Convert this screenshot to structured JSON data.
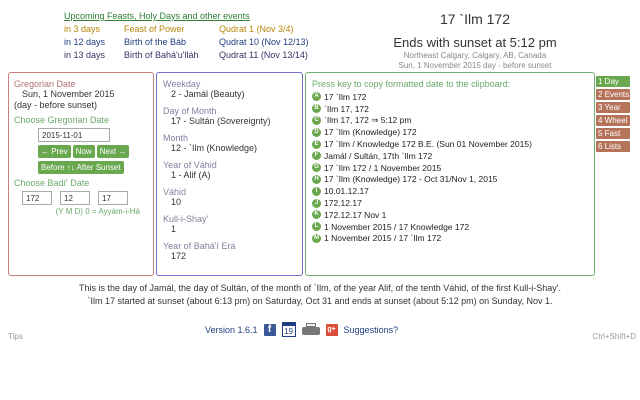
{
  "upcoming": {
    "header": "Upcoming Feasts, Holy Days and other events",
    "rows": [
      {
        "when": "in 3 days",
        "what": "Feast of Power",
        "date": "Qudrat 1 (Nov 3/4)"
      },
      {
        "when": "in 12 days",
        "what": "Birth of the Báb",
        "date": "Qudrat 10 (Nov 12/13)"
      },
      {
        "when": "in 13 days",
        "what": "Birth of Bahá'u'lláh",
        "date": "Qudrat 11 (Nov 13/14)"
      }
    ]
  },
  "today": {
    "badi_date": "17 `Ilm 172",
    "sunset": "Ends with sunset at 5:12 pm",
    "location": "Northeast Calgary, Calgary, AB, Canada",
    "greg_note": "Sun, 1 November 2015 day - before sunset"
  },
  "gregorian": {
    "title": "Gregorian Date",
    "value": "Sun, 1 November 2015",
    "note": "(day - before sunset)",
    "choose_label": "Choose Gregorian Date",
    "input_value": "2015-11-01",
    "prev": "← Prev",
    "now": "Now",
    "next": "Next →",
    "before_after": "Before ↑↓ After Sunset",
    "choose_badi_label": "Choose Badí' Date",
    "y": "172",
    "m": "12",
    "d": "17",
    "ymd_hint": "(Y M D) 0 = Ayyám-i-Há"
  },
  "badi": {
    "weekday_label": "Weekday",
    "weekday": "2 - Jamál (Beauty)",
    "dom_label": "Day of Month",
    "dom": "17 - Sultán (Sovereignty)",
    "month_label": "Month",
    "month": "12 - `Ilm (Knowledge)",
    "yov_label": "Year of Váhid",
    "yov": "1 - Alif (A)",
    "vahid_label": "Váhid",
    "vahid": "10",
    "kull_label": "Kull-i-Shay'",
    "kull": "1",
    "year_label": "Year of Bahá'í Era",
    "year": "172"
  },
  "copy": {
    "header": "Press key to copy formatted date to the clipboard:",
    "items": [
      {
        "key": "A",
        "text": "17 `Ilm 172"
      },
      {
        "key": "B",
        "text": "`Ilm 17, 172"
      },
      {
        "key": "C",
        "text": "`Ilm 17, 172 ⇒ 5:12 pm"
      },
      {
        "key": "D",
        "text": "17 `Ilm (Knowledge) 172"
      },
      {
        "key": "E",
        "text": "17 `Ilm / Knowledge 172 B.E. (Sun 01 November 2015)"
      },
      {
        "key": "F",
        "text": "Jamál / Sultán, 17th `Ilm 172"
      },
      {
        "key": "G",
        "text": "17 `Ilm 172 / 1 November 2015"
      },
      {
        "key": "H",
        "text": "17 `Ilm (Knowledge) 172 - Oct 31/Nov 1, 2015"
      },
      {
        "key": "I",
        "text": "10.01.12.17"
      },
      {
        "key": "J",
        "text": "172.12.17"
      },
      {
        "key": "K",
        "text": "172.12.17 Nov 1"
      },
      {
        "key": "L",
        "text": "1 November 2015 / 17 Knowledge 172"
      },
      {
        "key": "M",
        "text": "1 November 2015 / 17 `Ilm 172"
      }
    ]
  },
  "tabs": [
    {
      "label": "1 Day",
      "active": true
    },
    {
      "label": "2 Events",
      "active": false
    },
    {
      "label": "3 Year",
      "active": false
    },
    {
      "label": "4 Wheel",
      "active": false
    },
    {
      "label": "5 Fast",
      "active": false
    },
    {
      "label": "6 Lists",
      "active": false
    }
  ],
  "summary": {
    "line1": "This is the day of Jamál, the day of Sultán, of the month of `Ilm, of the year Alif, of the tenth Váhid, of the first Kull-i-Shay'.",
    "line2": "`Ilm 17 started at sunset (about 6:13 pm) on Saturday, Oct 31 and ends at sunset (about 5:12 pm) on Sunday, Nov 1."
  },
  "footer": {
    "tips": "Tips",
    "version": "Version 1.6.1",
    "calendar_day": "19",
    "suggestions": "Suggestions?",
    "shortcut": "Ctrl+Shift+D"
  },
  "colors": {
    "accent_green": "#6aa84f",
    "tab_inactive": "#b5735a",
    "greg_border": "#c98080",
    "badi_border": "#7070c8",
    "copy_border": "#70b070"
  },
  "icons": [
    "facebook-icon",
    "calendar-icon",
    "printer-icon",
    "google-plus-icon"
  ]
}
